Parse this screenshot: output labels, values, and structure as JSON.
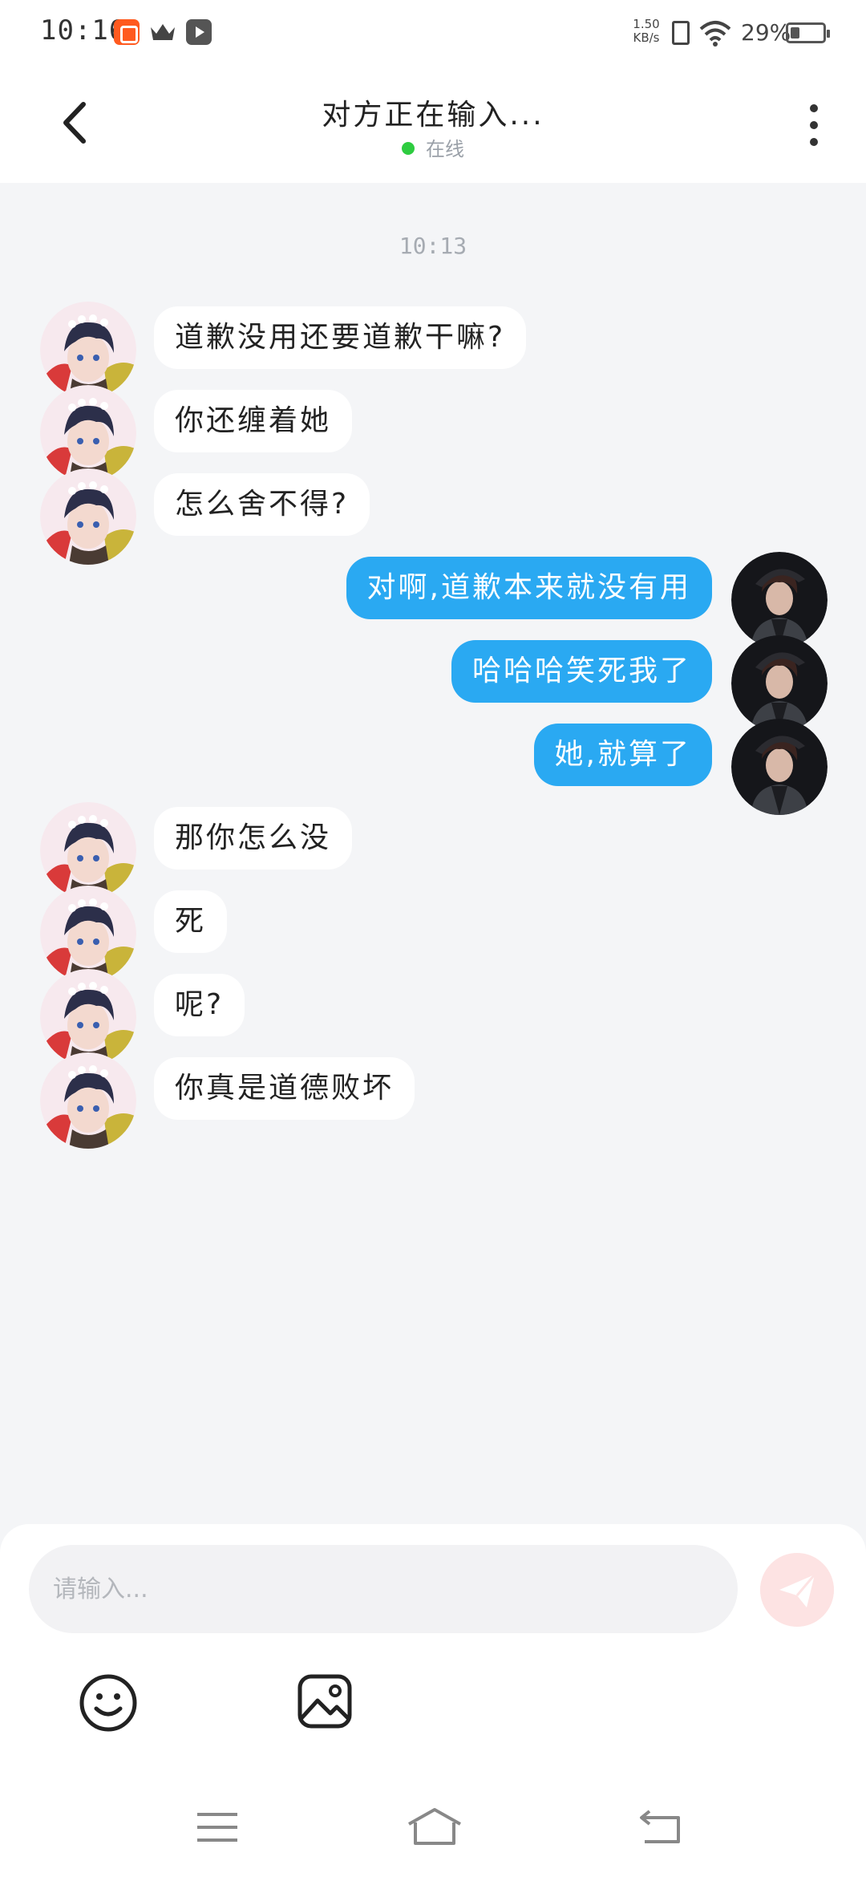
{
  "status_bar": {
    "time": "10:16",
    "net_speed_value": "1.50",
    "net_speed_unit": "KB/s",
    "battery_percent": "29%",
    "battery_level": 0.29,
    "icons": [
      "kuaishou-app-icon",
      "crown-icon",
      "video-app-icon",
      "sim-off-icon",
      "wifi-icon",
      "battery-icon"
    ]
  },
  "header": {
    "title": "对方正在输入...",
    "status": "在线",
    "status_color": "#2ecc40"
  },
  "chat": {
    "timestamp": "10:13",
    "messages": [
      {
        "side": "in",
        "text": "道歉没用还要道歉干嘛?"
      },
      {
        "side": "in",
        "text": "你还缠着她"
      },
      {
        "side": "in",
        "text": "怎么舍不得?"
      },
      {
        "side": "out",
        "text": "对啊,道歉本来就没有用"
      },
      {
        "side": "out",
        "text": "哈哈哈笑死我了"
      },
      {
        "side": "out",
        "text": "她,就算了"
      },
      {
        "side": "in",
        "text": "那你怎么没"
      },
      {
        "side": "in",
        "text": "死"
      },
      {
        "side": "in",
        "text": "呢?"
      },
      {
        "side": "in",
        "text": "你真是道德败坏"
      }
    ]
  },
  "composer": {
    "placeholder": "请输入...",
    "value": "",
    "send_button_color": "#fde3e3"
  },
  "colors": {
    "outgoing_bubble": "#2aa9f2",
    "incoming_bubble": "#ffffff",
    "chat_background": "#f4f5f7"
  }
}
